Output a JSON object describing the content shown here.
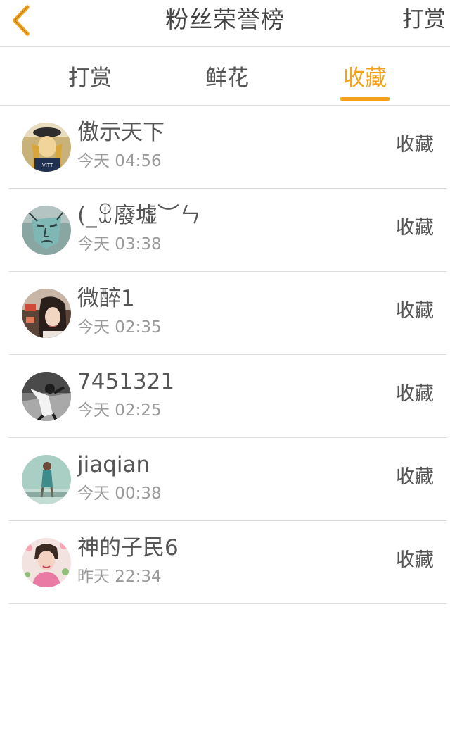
{
  "header": {
    "title": "粉丝荣誉榜",
    "action_label": "打赏",
    "accent_color": "#f4a21c"
  },
  "tabs": [
    {
      "label": "打赏",
      "active": false
    },
    {
      "label": "鲜花",
      "active": false
    },
    {
      "label": "收藏",
      "active": true
    }
  ],
  "list": [
    {
      "name": "傲示天下",
      "time": "今天 04:56",
      "badge": "收藏",
      "avatar_icon": "avatar-girl-hat"
    },
    {
      "name": "(_ꀾ廢墟︶ㄣ",
      "time": "今天 03:38",
      "badge": "收藏",
      "avatar_icon": "avatar-green-face"
    },
    {
      "name": "微醉1",
      "time": "今天 02:35",
      "badge": "收藏",
      "avatar_icon": "avatar-girl-photo"
    },
    {
      "name": "7451321",
      "time": "今天 02:25",
      "badge": "收藏",
      "avatar_icon": "avatar-bw-photo"
    },
    {
      "name": "jiaqian",
      "time": "今天 00:38",
      "badge": "收藏",
      "avatar_icon": "avatar-teal-photo"
    },
    {
      "name": "神的子民6",
      "time": "昨天 22:34",
      "badge": "收藏",
      "avatar_icon": "avatar-pink-photo"
    }
  ]
}
